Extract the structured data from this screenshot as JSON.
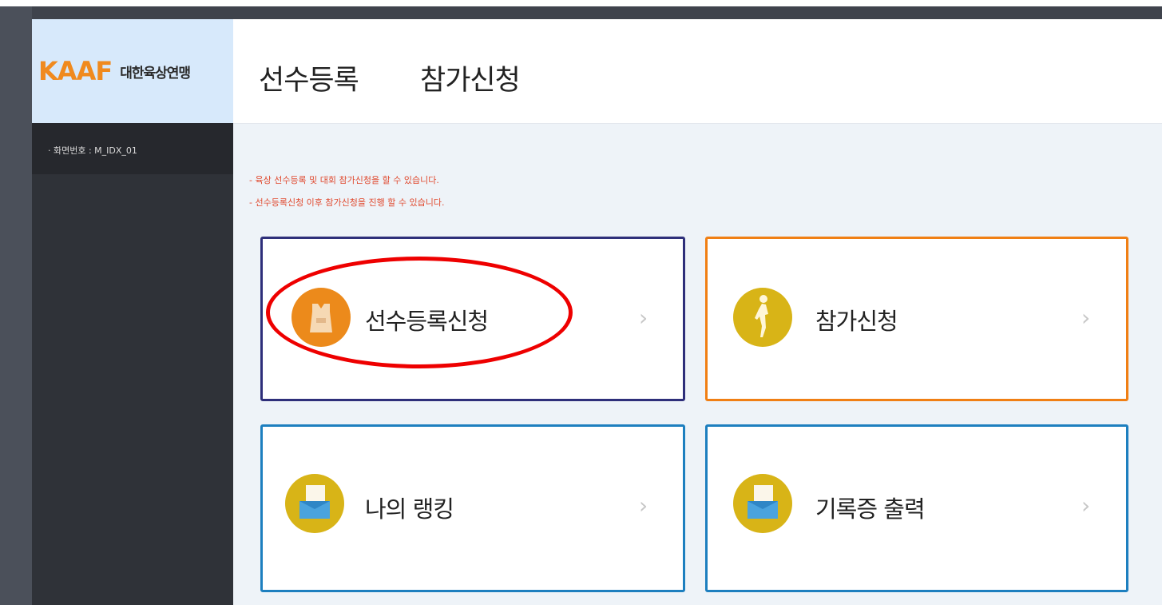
{
  "header": {
    "logo_mark": "KAAF",
    "logo_text": "대한육상연맹",
    "tabs": [
      "선수등록",
      "참가신청"
    ]
  },
  "sidebar": {
    "screen_number": "· 화면번호 : M_IDX_01"
  },
  "notices": [
    "- 육상 선수등록 및 대회 참가신청을 할 수 있습니다.",
    "- 선수등록신청 이후 참가신청을 진행 할 수 있습니다."
  ],
  "cards": [
    {
      "label": "선수등록신청",
      "icon": "athlete-vest-icon",
      "border_color": "#2e2f7a",
      "icon_color": "#ec8a1b"
    },
    {
      "label": "참가신청",
      "icon": "runner-icon",
      "border_color": "#f07f14",
      "icon_color": "#d8b417"
    },
    {
      "label": "나의 랭킹",
      "icon": "document-folder-icon",
      "border_color": "#1d7fbf",
      "icon_color": "#d8b417"
    },
    {
      "label": "기록증 출력",
      "icon": "document-folder-icon",
      "border_color": "#1d7fbf",
      "icon_color": "#d8b417"
    }
  ],
  "chevron": "›",
  "colors": {
    "highlight": "#ee0000",
    "notice": "#e04a2f",
    "sidebar": "#2f3238",
    "logo_bg": "#d7e9fb"
  }
}
